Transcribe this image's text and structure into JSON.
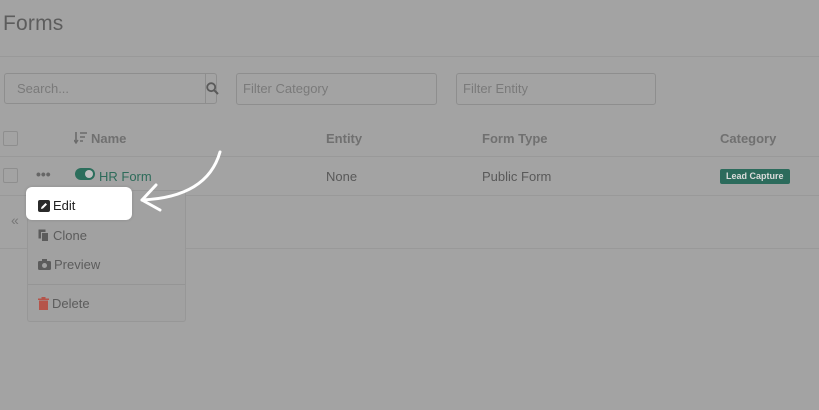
{
  "page": {
    "title": "Forms"
  },
  "toolbar": {
    "search_placeholder": "Search...",
    "filter_category_placeholder": "Filter Category",
    "filter_entity_placeholder": "Filter Entity"
  },
  "table": {
    "columns": [
      "Name",
      "Entity",
      "Form Type",
      "Category"
    ],
    "rows": [
      {
        "name": "HR Form",
        "entity": "None",
        "form_type": "Public Form",
        "category": "Lead Capture",
        "enabled": true
      }
    ]
  },
  "context_menu": {
    "items": [
      {
        "label": "Edit",
        "icon": "pencil-square-icon"
      },
      {
        "label": "Clone",
        "icon": "copy-icon"
      },
      {
        "label": "Preview",
        "icon": "camera-icon"
      },
      {
        "label": "Delete",
        "icon": "trash-icon"
      }
    ]
  },
  "pagination": {
    "prev_label": "«"
  },
  "colors": {
    "accent": "#2c6b5c",
    "danger": "#c0392b",
    "overlay": "#a3a3a3"
  }
}
